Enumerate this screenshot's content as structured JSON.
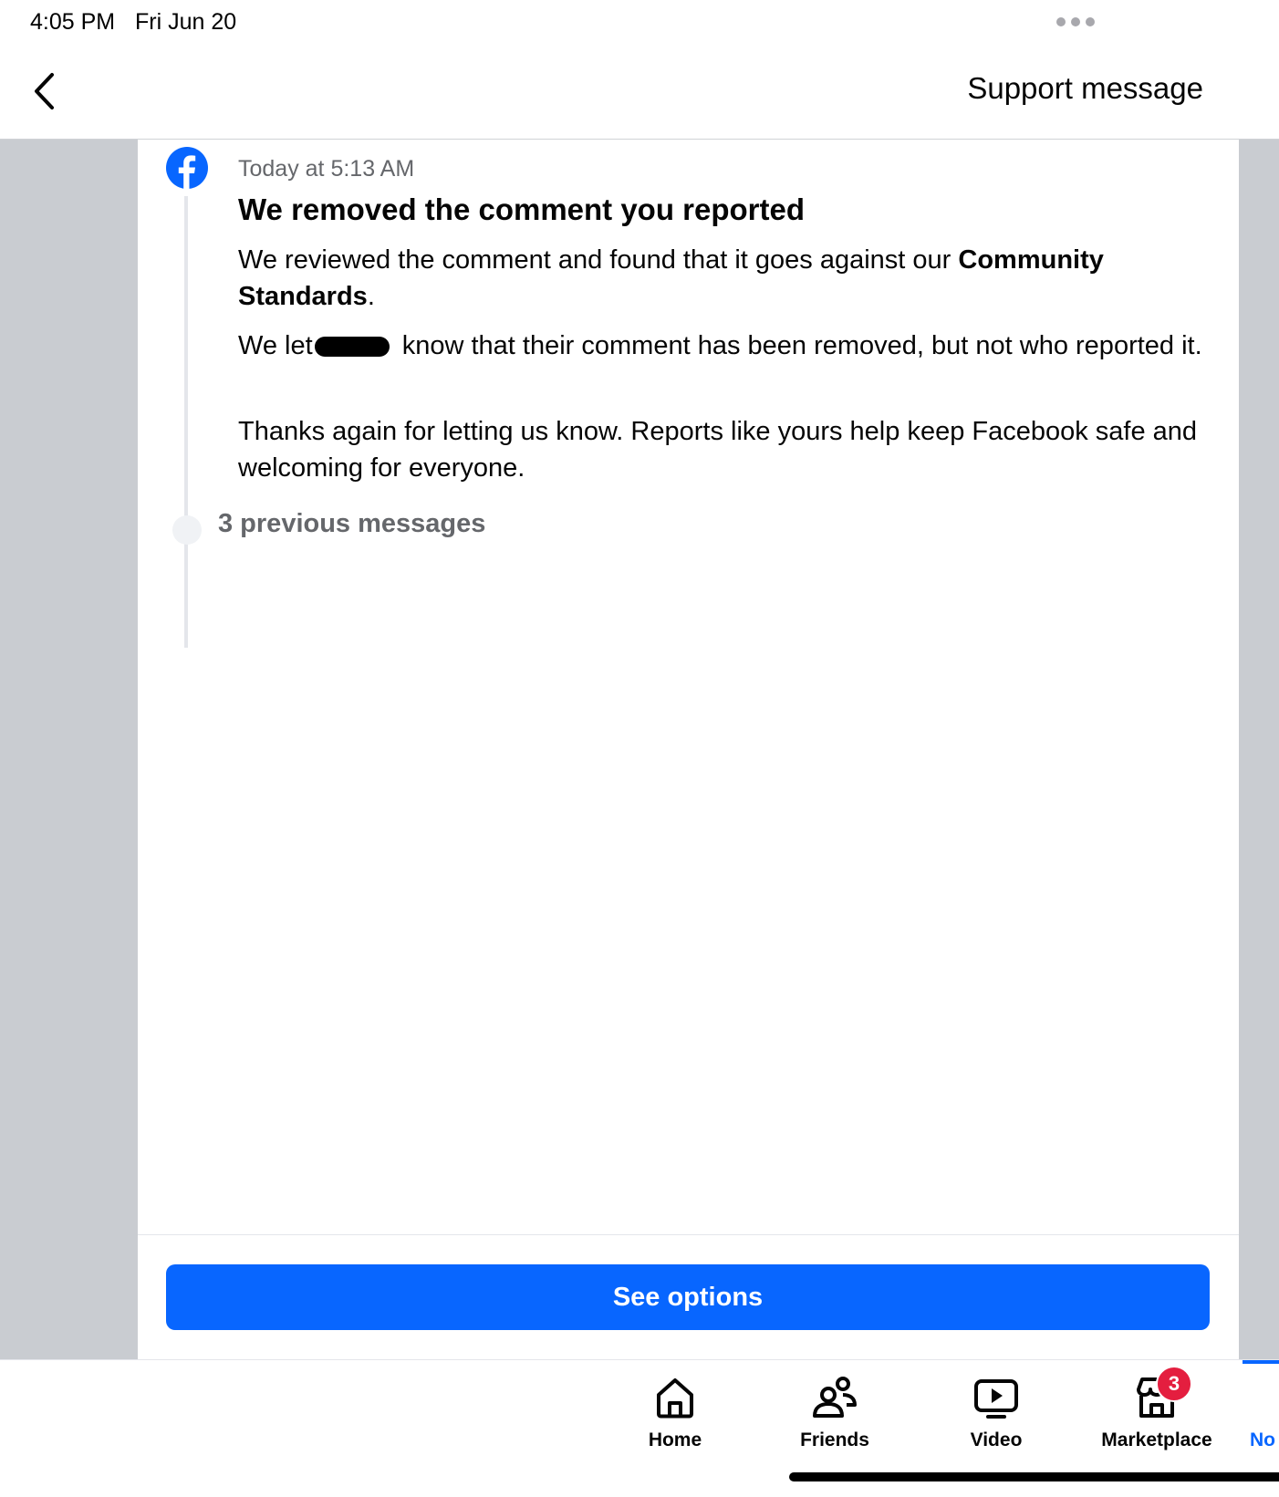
{
  "status_bar": {
    "time": "4:05 PM",
    "date": "Fri Jun 20"
  },
  "header": {
    "title": "Support message",
    "back_icon": "chevron-left-icon"
  },
  "message": {
    "sender_icon": "facebook-logo-icon",
    "timestamp": "Today at 5:13 AM",
    "title": "We removed the comment you reported",
    "p1_before": "We reviewed the comment and found that it goes against our ",
    "p1_bold": "Community Standards",
    "p1_after": ".",
    "p2_before": "We let",
    "p2_after": " know that their comment has been removed, but not who reported it.",
    "p3": "Thanks again for letting us know. Reports like yours help keep Facebook safe and welcoming for everyone."
  },
  "previous_messages_label": "3 previous messages",
  "action": {
    "see_options_label": "See options",
    "color": "#0866ff"
  },
  "tab_bar": {
    "tabs": [
      {
        "label": "Home",
        "icon": "home-icon"
      },
      {
        "label": "Friends",
        "icon": "friends-icon"
      },
      {
        "label": "Video",
        "icon": "video-icon"
      },
      {
        "label": "Marketplace",
        "icon": "marketplace-icon",
        "badge": "3"
      },
      {
        "label": "No",
        "icon": "notifications-icon",
        "active": true
      }
    ]
  },
  "colors": {
    "accent": "#0866ff",
    "badge": "#e41e3f",
    "secondary_text": "#65676b",
    "side_gray": "#c9ccd1"
  }
}
